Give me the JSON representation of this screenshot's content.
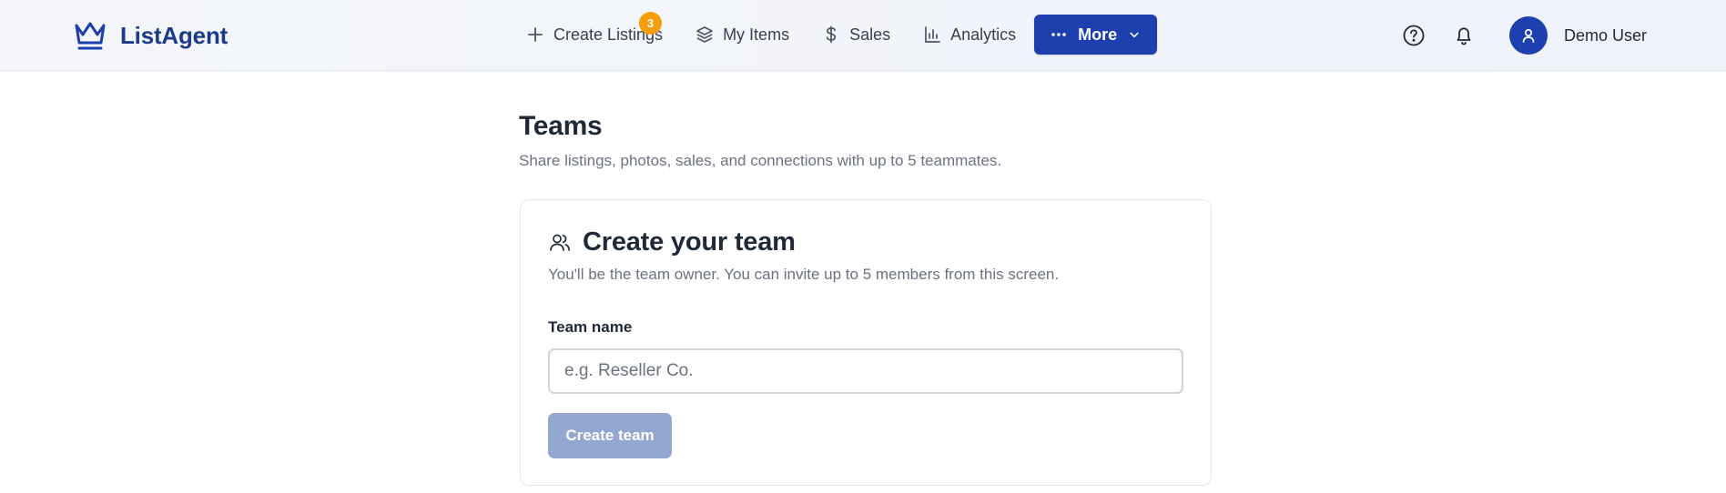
{
  "app": {
    "brand_name": "ListAgent",
    "brand_icon": "crown-icon",
    "accent_color": "#1e40af",
    "badge_color": "#f59e0b"
  },
  "nav": {
    "items": [
      {
        "label": "Create Listings",
        "icon": "plus-icon",
        "badge": "3"
      },
      {
        "label": "My Items",
        "icon": "layers-icon"
      },
      {
        "label": "Sales",
        "icon": "dollar-icon"
      },
      {
        "label": "Analytics",
        "icon": "bar-chart-icon"
      }
    ],
    "more_label": "More",
    "more_icon": "ellipsis-icon"
  },
  "header_tools": {
    "help_icon": "help-circle-icon",
    "notifications_icon": "bell-icon",
    "user_name": "Demo User",
    "avatar_icon": "user-icon"
  },
  "page": {
    "title": "Teams",
    "subtitle": "Share listings, photos, sales, and connections with up to 5 teammates."
  },
  "create_team_card": {
    "icon": "users-icon",
    "title": "Create your team",
    "description": "You'll be the team owner. You can invite up to 5 members from this screen.",
    "field_label": "Team name",
    "input_value": "",
    "input_placeholder": "e.g. Reseller Co.",
    "submit_label": "Create team",
    "submit_disabled": true
  }
}
